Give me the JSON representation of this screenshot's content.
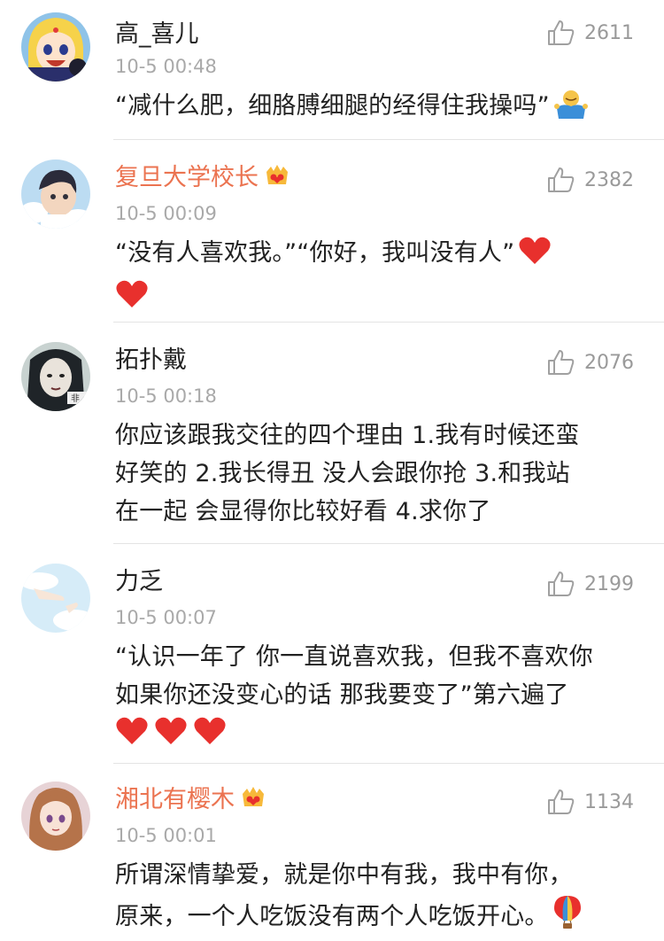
{
  "comments": [
    {
      "user": "高_喜儿",
      "time": "10-5 00:48",
      "likes": "2611",
      "text": "“减什么肥，细胳膊细腿的经得住我操吗”",
      "emoji": "shrug-person-emoji",
      "vip": false
    },
    {
      "user": "复旦大学校长",
      "time": "10-5 00:09",
      "likes": "2382",
      "text": "“没有人喜欢我。”“你好，我叫没有人”",
      "emoji": "red-heart-emoji",
      "vip": true
    },
    {
      "user": "拓扑戴",
      "time": "10-5 00:18",
      "likes": "2076",
      "text_lines": [
        "你应该跟我交往的四个理由 1.我有时候还蛮",
        "好笑的 2.我长得丑  没人会跟你抢 3.和我站",
        "在一起  会显得你比较好看 4.求你了"
      ],
      "vip": false
    },
    {
      "user": "力乏",
      "time": "10-5 00:07",
      "likes": "2199",
      "text_lines": [
        "“认识一年了 你一直说喜欢我，但我不喜欢你",
        "如果你还没变心的话 那我要变了”第六遍了"
      ],
      "emoji": "red-heart-emoji",
      "vip": false
    },
    {
      "user": "湘北有樱木",
      "time": "10-5 00:01",
      "likes": "1134",
      "text_lines": [
        "所谓深情挚爱，就是你中有我，我中有你，",
        "原来，一个人吃饭没有两个人吃饭开心。"
      ],
      "emoji": "hot-air-balloon-emoji",
      "vip": true
    }
  ],
  "colors": {
    "vip_name": "#eb7350",
    "timestamp": "#a9a9a9",
    "heart": "#e8302d"
  }
}
